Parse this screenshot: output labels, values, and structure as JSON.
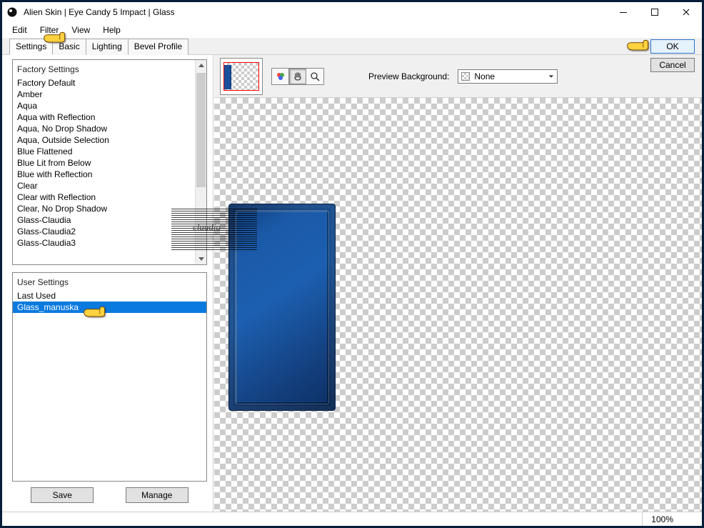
{
  "window": {
    "title": "Alien Skin | Eye Candy 5 Impact | Glass"
  },
  "menus": {
    "edit": "Edit",
    "filter": "Filter",
    "view": "View",
    "help": "Help"
  },
  "tabs": {
    "settings": "Settings",
    "basic": "Basic",
    "lighting": "Lighting",
    "bevel": "Bevel Profile"
  },
  "buttons": {
    "ok": "OK",
    "cancel": "Cancel",
    "save": "Save",
    "manage": "Manage"
  },
  "factory": {
    "heading": "Factory Settings",
    "items": [
      "Factory Default",
      "Amber",
      "Aqua",
      "Aqua with Reflection",
      "Aqua, No Drop Shadow",
      "Aqua, Outside Selection",
      "Blue Flattened",
      "Blue Lit from Below",
      "Blue with Reflection",
      "Clear",
      "Clear with Reflection",
      "Clear, No Drop Shadow",
      "Glass-Claudia",
      "Glass-Claudia2",
      "Glass-Claudia3"
    ]
  },
  "user": {
    "heading": "User Settings",
    "items": [
      "Last Used",
      "Glass_manuska"
    ],
    "selected_index": 1
  },
  "preview": {
    "label": "Preview Background:",
    "value": "None"
  },
  "status": {
    "zoom": "100%"
  }
}
